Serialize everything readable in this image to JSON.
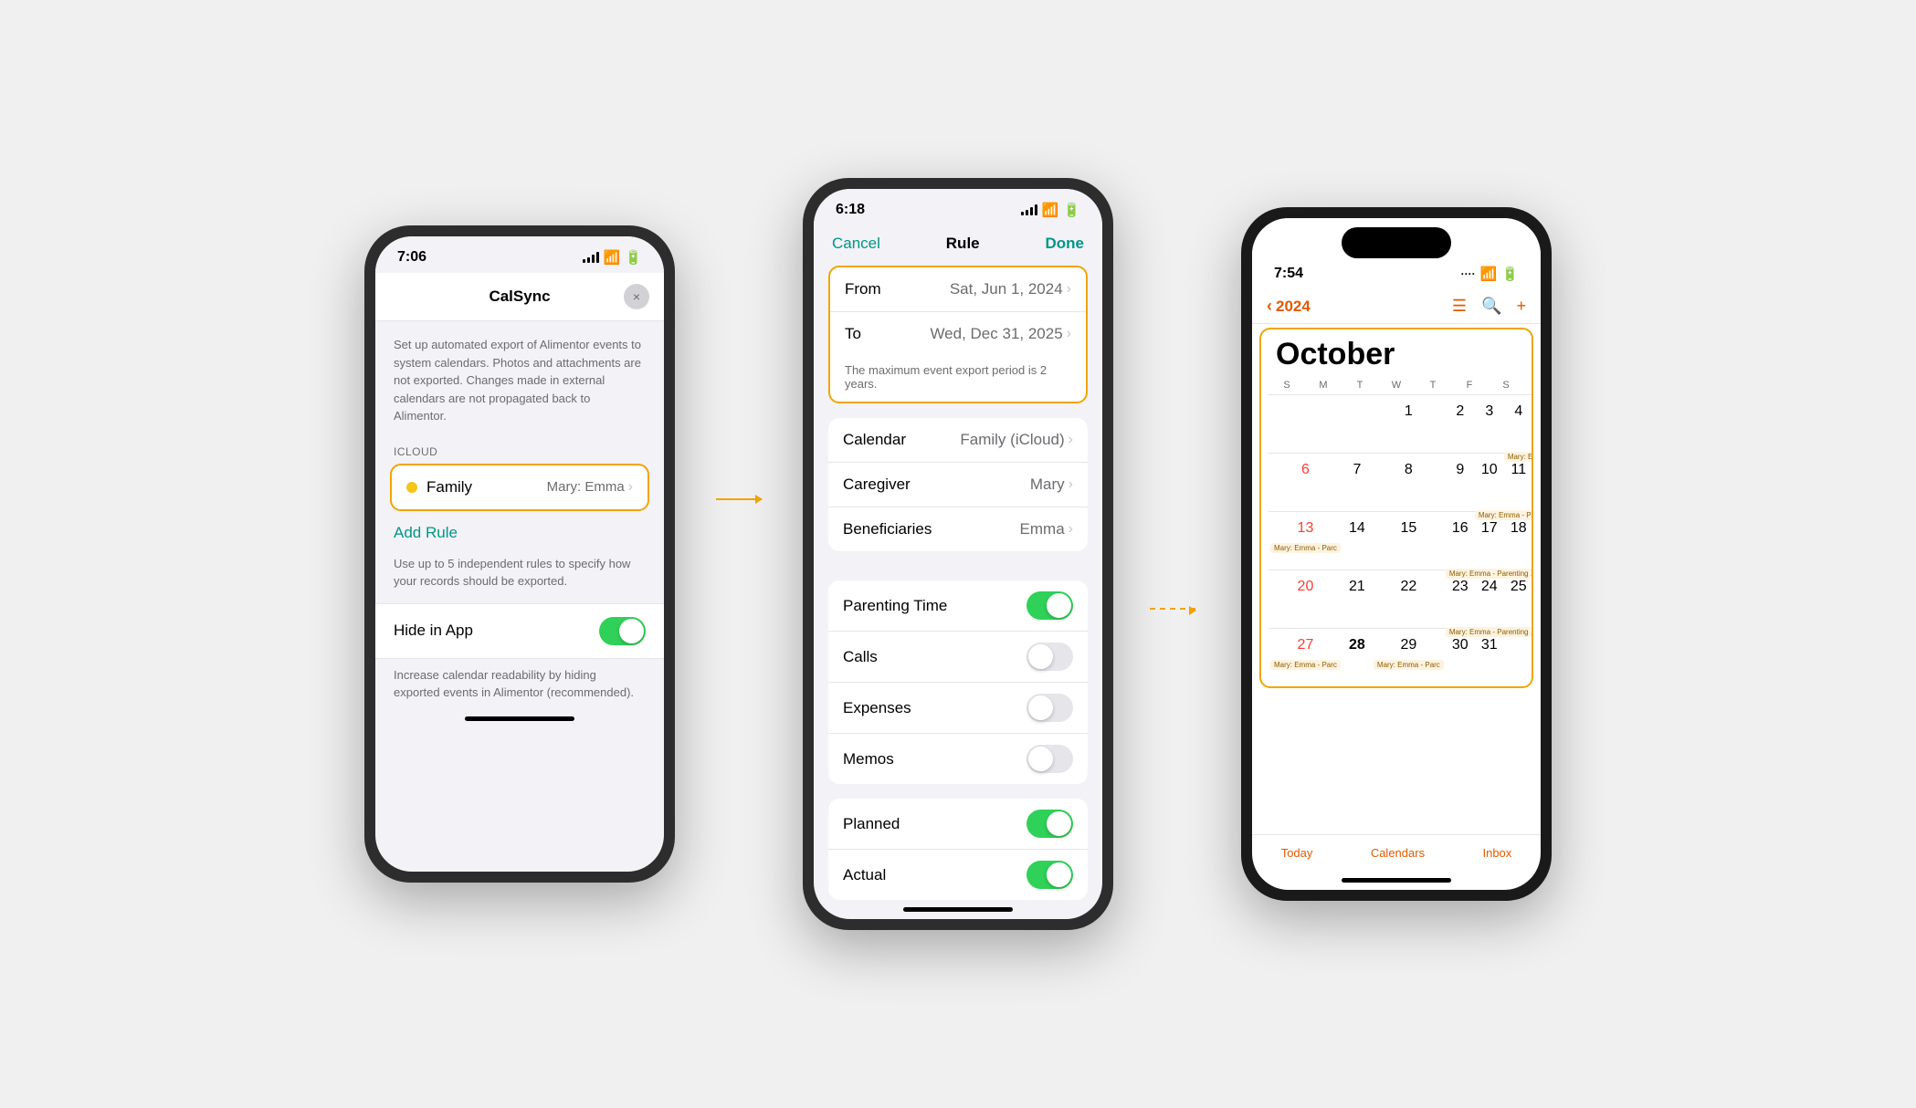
{
  "phone1": {
    "status_time": "7:06",
    "app_title": "CalSync",
    "close_btn": "×",
    "description": "Set up automated export of Alimentor events to system calendars. Photos and attachments are not exported. Changes made in external calendars are not propagated back to Alimentor.",
    "icloud_label": "ICLOUD",
    "family_name": "Family",
    "family_value": "Mary: Emma",
    "add_rule_label": "Add Rule",
    "add_rule_desc": "Use up to 5 independent rules to specify how your records should be exported.",
    "hide_in_app_label": "Hide in App",
    "hide_in_app_desc": "Increase calendar readability by hiding exported events in Alimentor (recommended)."
  },
  "phone2": {
    "status_time": "6:18",
    "cancel_label": "Cancel",
    "nav_title": "Rule",
    "done_label": "Done",
    "from_label": "From",
    "from_value": "Sat, Jun 1, 2024",
    "to_label": "To",
    "to_value": "Wed, Dec 31, 2025",
    "date_note": "The maximum event export period is 2 years.",
    "calendar_label": "Calendar",
    "calendar_value": "Family (iCloud)",
    "caregiver_label": "Caregiver",
    "caregiver_value": "Mary",
    "beneficiaries_label": "Beneficiaries",
    "beneficiaries_value": "Emma",
    "parenting_time_label": "Parenting Time",
    "calls_label": "Calls",
    "expenses_label": "Expenses",
    "memos_label": "Memos",
    "planned_label": "Planned",
    "actual_label": "Actual"
  },
  "phone3": {
    "status_time": "7:54",
    "year": "2024",
    "month_title": "October",
    "weekdays": [
      "S",
      "M",
      "T",
      "W",
      "T",
      "F",
      "S"
    ],
    "events": {
      "week1": "Mary: Emma - Parenting Time",
      "week2": "Mary: Emma - Parenting Time",
      "week3a": "Mary: Emma - Parc",
      "week3b": "Mary: Emma - Parenting Time",
      "week4": "Mary: Emma - Parenting Time",
      "week5a": "Mary: Emma - Parc",
      "week5b": "Mary: Emma - Parc"
    },
    "today_label": "Today",
    "calendars_label": "Calendars",
    "inbox_label": "Inbox"
  },
  "connectors": {
    "arrow1_label": "→",
    "arrow2_label": "- ->"
  }
}
